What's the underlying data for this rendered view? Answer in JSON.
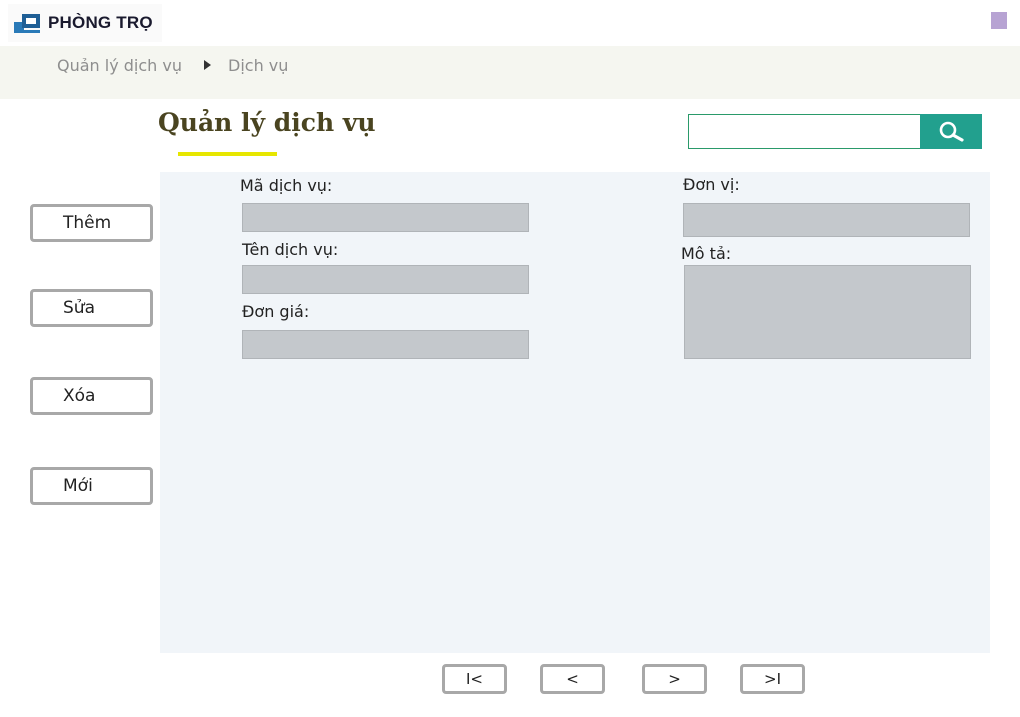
{
  "header": {
    "logo_text": "PHÒNG TRỌ",
    "corner_color": "#b7a3d3"
  },
  "breadcrumb": {
    "items": [
      "Quản lý dịch vụ",
      "Dịch vụ"
    ]
  },
  "page": {
    "title": "Quản lý dịch vụ"
  },
  "search": {
    "value": "",
    "icon": "search-icon",
    "button_color": "#22a08e"
  },
  "sidebar": {
    "buttons": [
      "Thêm",
      "Sửa",
      "Xóa",
      "Mới"
    ]
  },
  "form": {
    "ma_dich_vu": {
      "label": "Mã dịch vụ:",
      "value": ""
    },
    "ten_dich_vu": {
      "label": "Tên dịch vụ:",
      "value": ""
    },
    "don_gia": {
      "label": "Đơn giá:",
      "value": ""
    },
    "don_vi": {
      "label": "Đơn vị:",
      "value": ""
    },
    "mo_ta": {
      "label": "Mô tả:",
      "value": ""
    }
  },
  "pagination": {
    "first": "I<",
    "prev": "<",
    "next": ">",
    "last": ">I"
  }
}
